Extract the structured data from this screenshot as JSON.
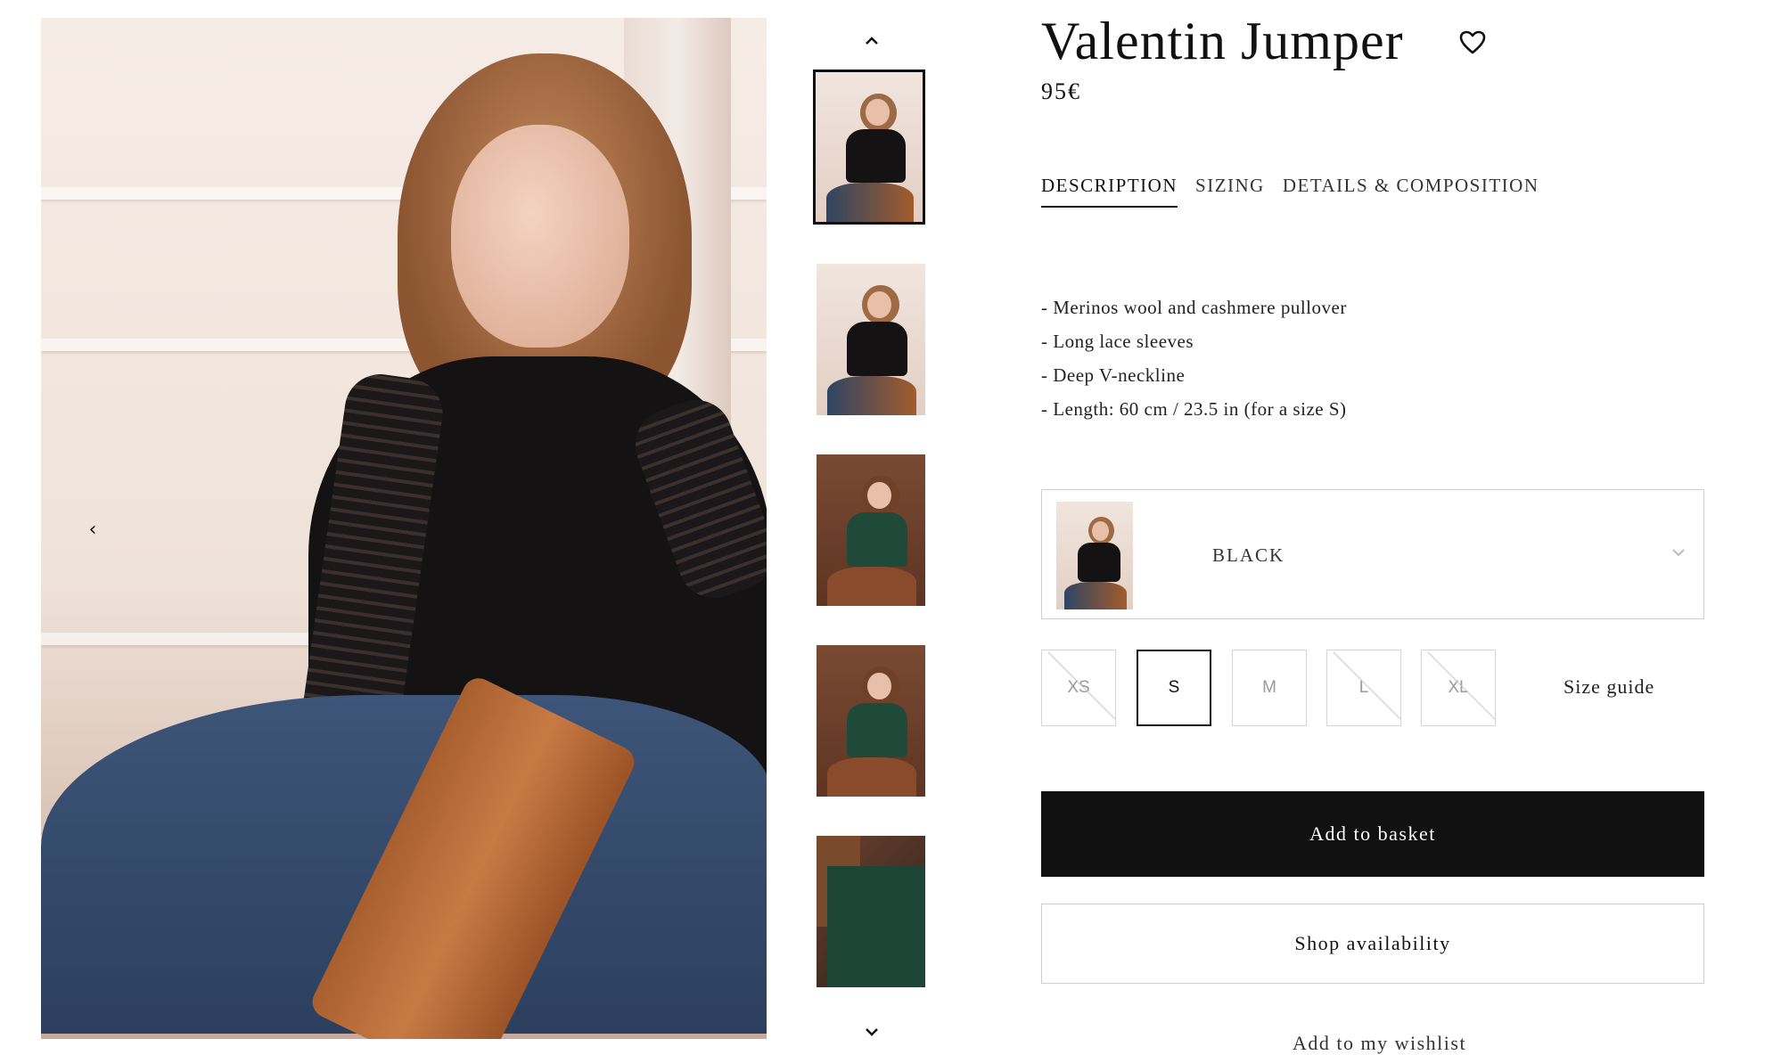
{
  "product": {
    "title": "Valentin Jumper",
    "price": "95€"
  },
  "tabs": [
    {
      "label": "DESCRIPTION",
      "active": true
    },
    {
      "label": "SIZING",
      "active": false
    },
    {
      "label": "DETAILS & COMPOSITION",
      "active": false
    }
  ],
  "description": [
    "- Merinos wool and cashmere pullover",
    "- Long lace sleeves",
    "- Deep V-neckline",
    "- Length: 60 cm / 23.5 in (for a size S)"
  ],
  "color_select": {
    "selected": "BLACK",
    "icon": "chevron-down-icon"
  },
  "sizes": [
    {
      "label": "XS",
      "available": false,
      "selected": false
    },
    {
      "label": "S",
      "available": true,
      "selected": true
    },
    {
      "label": "M",
      "available": true,
      "selected": false
    },
    {
      "label": "L",
      "available": false,
      "selected": false
    },
    {
      "label": "XL",
      "available": false,
      "selected": false
    }
  ],
  "size_guide_label": "Size guide",
  "buttons": {
    "add_to_basket": "Add to basket",
    "shop_availability": "Shop availability"
  },
  "partial_text": "Add to my wishlist",
  "icons": {
    "wishlist": "heart-icon",
    "gallery_prev": "chevron-left-icon",
    "thumbs_up": "chevron-up-icon",
    "thumbs_down": "chevron-down-icon"
  },
  "colors": {
    "primary": "#111111",
    "border": "#cfcfcf",
    "unavailable_text": "#9a9a9a"
  }
}
